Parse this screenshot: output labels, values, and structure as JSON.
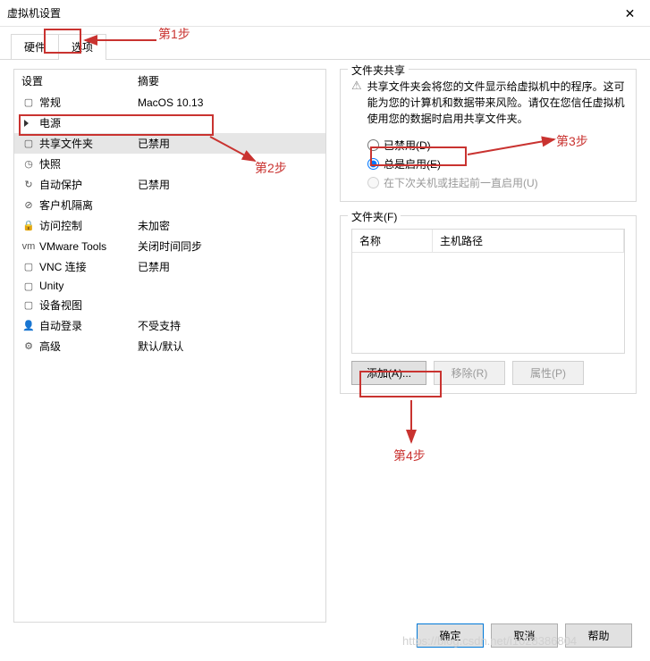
{
  "window": {
    "title": "虚拟机设置"
  },
  "tabs": {
    "hardware": "硬件",
    "options": "选项"
  },
  "left": {
    "header": {
      "setting": "设置",
      "summary": "摘要"
    },
    "items": [
      {
        "name": "常规",
        "summary": "MacOS 10.13",
        "icon": "▢"
      },
      {
        "name": "电源",
        "summary": "",
        "icon": "▶"
      },
      {
        "name": "共享文件夹",
        "summary": "已禁用",
        "icon": "▢",
        "selected": true
      },
      {
        "name": "快照",
        "summary": "",
        "icon": "◷"
      },
      {
        "name": "自动保护",
        "summary": "已禁用",
        "icon": "↻"
      },
      {
        "name": "客户机隔离",
        "summary": "",
        "icon": "⊘"
      },
      {
        "name": "访问控制",
        "summary": "未加密",
        "icon": "🔒"
      },
      {
        "name": "VMware Tools",
        "summary": "关闭时间同步",
        "icon": "vm"
      },
      {
        "name": "VNC 连接",
        "summary": "已禁用",
        "icon": "▢"
      },
      {
        "name": "Unity",
        "summary": "",
        "icon": "▢"
      },
      {
        "name": "设备视图",
        "summary": "",
        "icon": "▢"
      },
      {
        "name": "自动登录",
        "summary": "不受支持",
        "icon": "👤"
      },
      {
        "name": "高级",
        "summary": "默认/默认",
        "icon": "⚙"
      }
    ]
  },
  "right": {
    "share": {
      "legend": "文件夹共享",
      "info": "共享文件夹会将您的文件显示给虚拟机中的程序。这可能为您的计算机和数据带来风险。请仅在您信任虚拟机使用您的数据时启用共享文件夹。",
      "radio_disabled": "已禁用(D)",
      "radio_always": "总是启用(E)",
      "radio_until": "在下次关机或挂起前一直启用(U)"
    },
    "folders": {
      "legend": "文件夹(F)",
      "col_name": "名称",
      "col_path": "主机路径",
      "btn_add": "添加(A)...",
      "btn_remove": "移除(R)",
      "btn_props": "属性(P)"
    }
  },
  "footer": {
    "ok": "确定",
    "cancel": "取消",
    "help": "帮助"
  },
  "annotations": {
    "step1": "第1步",
    "step2": "第2步",
    "step3": "第3步",
    "step4": "第4步"
  },
  "watermark": "https://blog.csdn.net/i1028386804"
}
